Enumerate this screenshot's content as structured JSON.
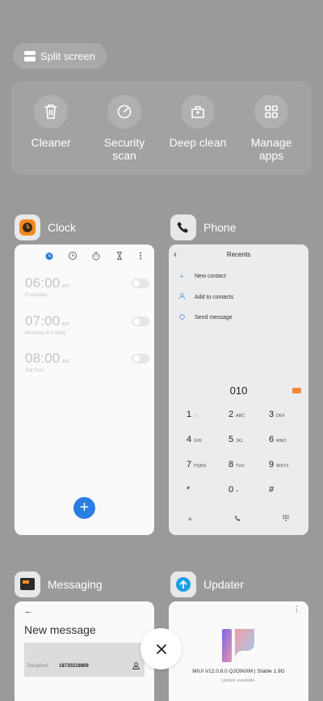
{
  "split_screen": {
    "label": "Split screen"
  },
  "tools": [
    {
      "label": "Cleaner",
      "icon": "trash-icon"
    },
    {
      "label": "Security\nscan",
      "icon": "shield-gauge-icon"
    },
    {
      "label": "Deep clean",
      "icon": "briefcase-clean-icon"
    },
    {
      "label": "Manage\napps",
      "icon": "grid-apps-icon"
    }
  ],
  "apps": {
    "clock": {
      "name": "Clock",
      "alarms": [
        {
          "time": "06:00",
          "ampm": "am",
          "repeat": "Everyday"
        },
        {
          "time": "07:00",
          "ampm": "am",
          "repeat": "Monday to Friday"
        },
        {
          "time": "08:00",
          "ampm": "am",
          "repeat": "Sat Sun"
        }
      ],
      "fab": "+"
    },
    "phone": {
      "name": "Phone",
      "title": "Recents",
      "actions": [
        {
          "label": "New contact",
          "icon": "plus-icon"
        },
        {
          "label": "Add to contacts",
          "icon": "person-icon"
        },
        {
          "label": "Send message",
          "icon": "message-icon"
        }
      ],
      "number": "010",
      "keys": [
        {
          "digit": "1",
          "letters": "◌◌"
        },
        {
          "digit": "2",
          "letters": "ABC"
        },
        {
          "digit": "3",
          "letters": "DEF"
        },
        {
          "digit": "4",
          "letters": "GHI"
        },
        {
          "digit": "5",
          "letters": "JKL"
        },
        {
          "digit": "6",
          "letters": "MNO"
        },
        {
          "digit": "7",
          "letters": "PQRS"
        },
        {
          "digit": "8",
          "letters": "TUV"
        },
        {
          "digit": "9",
          "letters": "WXYZ"
        },
        {
          "digit": "*",
          "letters": ""
        },
        {
          "digit": "0",
          "letters": "+"
        },
        {
          "digit": "#",
          "letters": ""
        }
      ]
    },
    "messaging": {
      "name": "Messaging",
      "title": "New message",
      "recipient_label": "Recipient:",
      "recipient_value": "18730218809"
    },
    "updater": {
      "name": "Updater",
      "version": "MIUI V12.0.8.0.QJOINXM | Stable 1.9G",
      "status": "Update available."
    }
  },
  "colors": {
    "background": "#9a9a9a",
    "accent_blue": "#2a7de1",
    "delete_orange": "#f08a3a"
  }
}
